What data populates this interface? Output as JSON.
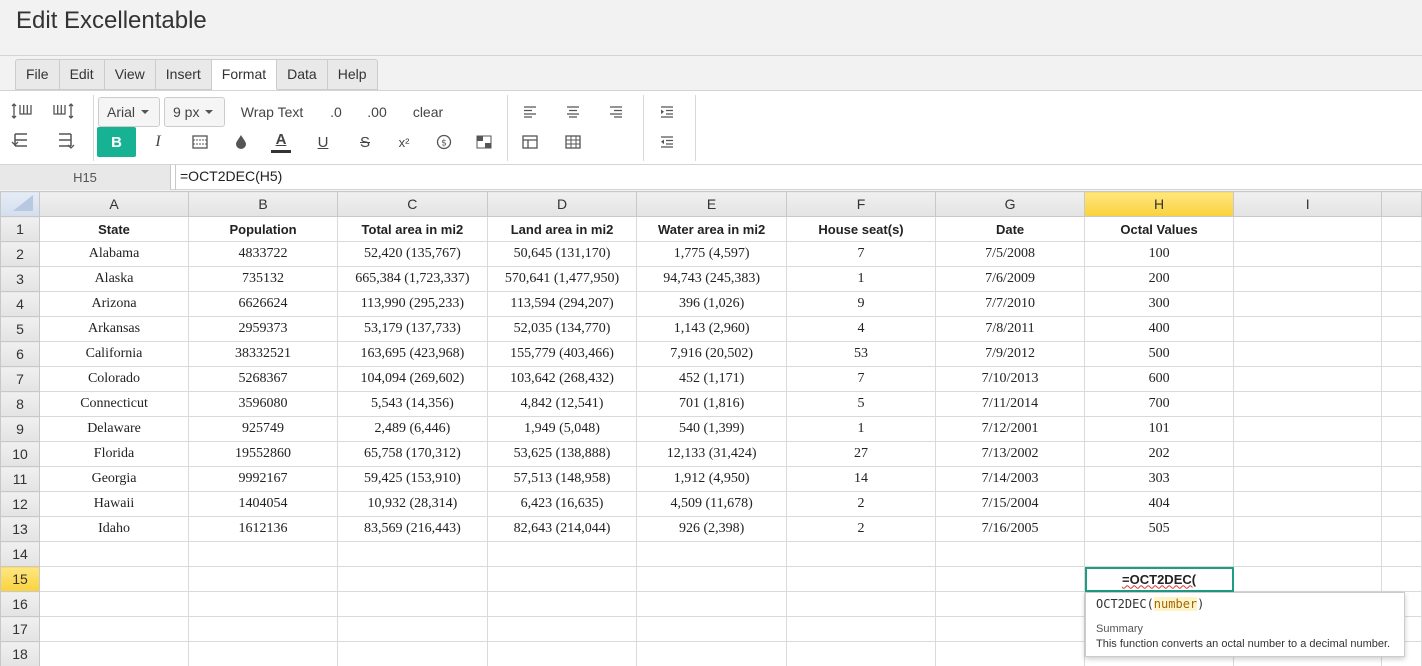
{
  "app": {
    "title": "Edit Excellentable"
  },
  "menu": {
    "items": [
      "File",
      "Edit",
      "View",
      "Insert",
      "Format",
      "Data",
      "Help"
    ],
    "active": "Format"
  },
  "toolbar": {
    "font_family": "Arial",
    "font_size": "9 px",
    "wrap_text": "Wrap Text",
    "decimal_decrease": ".0",
    "decimal_increase": ".00",
    "clear": "clear",
    "bold": "B",
    "italic": "I",
    "font_color_glyph": "A",
    "underline": "U",
    "strike": "S",
    "superscript": "x²",
    "accent_color": "#17b294",
    "icons": [
      "insert-row-above-icon",
      "insert-column-right-icon",
      "delete-row-icon",
      "delete-column-icon",
      "borders-icon",
      "fill-color-icon",
      "currency-icon",
      "conditional-format-icon",
      "align-left-icon",
      "align-center-icon",
      "align-right-icon",
      "table-icon",
      "table-grid-icon",
      "indent-increase-icon",
      "indent-decrease-icon"
    ]
  },
  "formula_bar": {
    "cell_ref": "H15",
    "formula": "=OCT2DEC(H5)"
  },
  "grid": {
    "columns": [
      "A",
      "B",
      "C",
      "D",
      "E",
      "F",
      "G",
      "H",
      "I"
    ],
    "selected_column": "H",
    "selected_row": "15",
    "header_row": [
      "State",
      "Population",
      "Total area in mi2",
      "Land area in mi2",
      "Water area in mi2",
      "House seat(s)",
      "Date",
      "Octal Values",
      ""
    ],
    "rows": [
      [
        "Alabama",
        "4833722",
        "52,420 (135,767)",
        "50,645 (131,170)",
        "1,775 (4,597)",
        "7",
        "7/5/2008",
        "100",
        ""
      ],
      [
        "Alaska",
        "735132",
        "665,384 (1,723,337)",
        "570,641 (1,477,950)",
        "94,743 (245,383)",
        "1",
        "7/6/2009",
        "200",
        ""
      ],
      [
        "Arizona",
        "6626624",
        "113,990 (295,233)",
        "113,594 (294,207)",
        "396 (1,026)",
        "9",
        "7/7/2010",
        "300",
        ""
      ],
      [
        "Arkansas",
        "2959373",
        "53,179 (137,733)",
        "52,035 (134,770)",
        "1,143 (2,960)",
        "4",
        "7/8/2011",
        "400",
        ""
      ],
      [
        "California",
        "38332521",
        "163,695 (423,968)",
        "155,779 (403,466)",
        "7,916 (20,502)",
        "53",
        "7/9/2012",
        "500",
        ""
      ],
      [
        "Colorado",
        "5268367",
        "104,094 (269,602)",
        "103,642 (268,432)",
        "452 (1,171)",
        "7",
        "7/10/2013",
        "600",
        ""
      ],
      [
        "Connecticut",
        "3596080",
        "5,543 (14,356)",
        "4,842 (12,541)",
        "701 (1,816)",
        "5",
        "7/11/2014",
        "700",
        ""
      ],
      [
        "Delaware",
        "925749",
        "2,489 (6,446)",
        "1,949 (5,048)",
        "540 (1,399)",
        "1",
        "7/12/2001",
        "101",
        ""
      ],
      [
        "Florida",
        "19552860",
        "65,758 (170,312)",
        "53,625 (138,888)",
        "12,133 (31,424)",
        "27",
        "7/13/2002",
        "202",
        ""
      ],
      [
        "Georgia",
        "9992167",
        "59,425 (153,910)",
        "57,513 (148,958)",
        "1,912 (4,950)",
        "14",
        "7/14/2003",
        "303",
        ""
      ],
      [
        "Hawaii",
        "1404054",
        "10,932 (28,314)",
        "6,423 (16,635)",
        "4,509 (11,678)",
        "2",
        "7/15/2004",
        "404",
        ""
      ],
      [
        "Idaho",
        "1612136",
        "83,569 (216,443)",
        "82,643 (214,044)",
        "926 (2,398)",
        "2",
        "7/16/2005",
        "505",
        ""
      ]
    ],
    "editing_cell_text": "=OCT2DEC(",
    "row_numbers": [
      "1",
      "2",
      "3",
      "4",
      "5",
      "6",
      "7",
      "8",
      "9",
      "10",
      "11",
      "12",
      "13",
      "14",
      "15",
      "16",
      "17",
      "18"
    ]
  },
  "autocomplete": {
    "func_name": "OCT2DEC(",
    "arg": "number",
    "close": ")",
    "summary_label": "Summary",
    "summary_text": "This function converts an octal number to a decimal number."
  }
}
